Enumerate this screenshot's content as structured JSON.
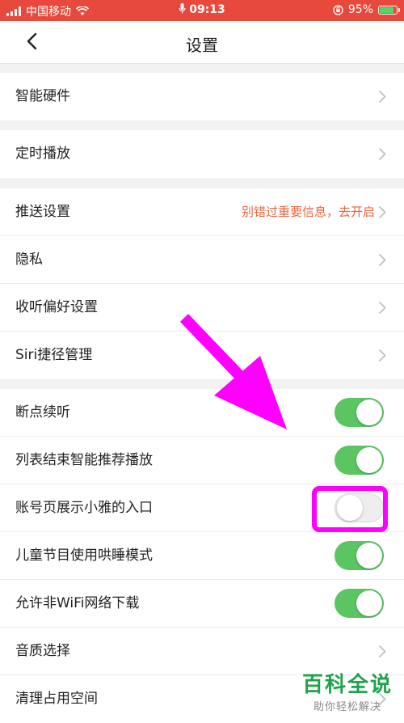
{
  "status_bar": {
    "carrier": "中国移动",
    "time": "09:13",
    "battery": "95%",
    "battery_level": 0.95
  },
  "nav": {
    "title": "设置",
    "back_icon": "chevron-left-icon"
  },
  "groups": [
    {
      "items": [
        {
          "label": "智能硬件",
          "type": "link"
        }
      ]
    },
    {
      "items": [
        {
          "label": "定时播放",
          "type": "link"
        }
      ]
    },
    {
      "items": [
        {
          "label": "推送设置",
          "type": "link",
          "hint": "别错过重要信息，去开启"
        },
        {
          "label": "隐私",
          "type": "link"
        },
        {
          "label": "收听偏好设置",
          "type": "link"
        },
        {
          "label": "Siri捷径管理",
          "type": "link"
        }
      ]
    },
    {
      "items": [
        {
          "label": "断点续听",
          "type": "toggle",
          "on": true
        },
        {
          "label": "列表结束智能推荐播放",
          "type": "toggle",
          "on": true
        },
        {
          "label": "账号页展示小雅的入口",
          "type": "toggle",
          "on": false
        },
        {
          "label": "儿童节目使用哄睡模式",
          "type": "toggle",
          "on": true
        },
        {
          "label": "允许非WiFi网络下载",
          "type": "toggle",
          "on": true
        },
        {
          "label": "音质选择",
          "type": "link"
        },
        {
          "label": "清理占用空间",
          "type": "link"
        }
      ]
    }
  ],
  "watermark": {
    "main": "百科全说",
    "sub": "助你轻松解决"
  },
  "colors": {
    "status_bar": "#e8493d",
    "toggle_on": "#5ac561",
    "hint": "#e8663d",
    "annotation": "#ff00ff",
    "watermark": "#1ea34a"
  }
}
